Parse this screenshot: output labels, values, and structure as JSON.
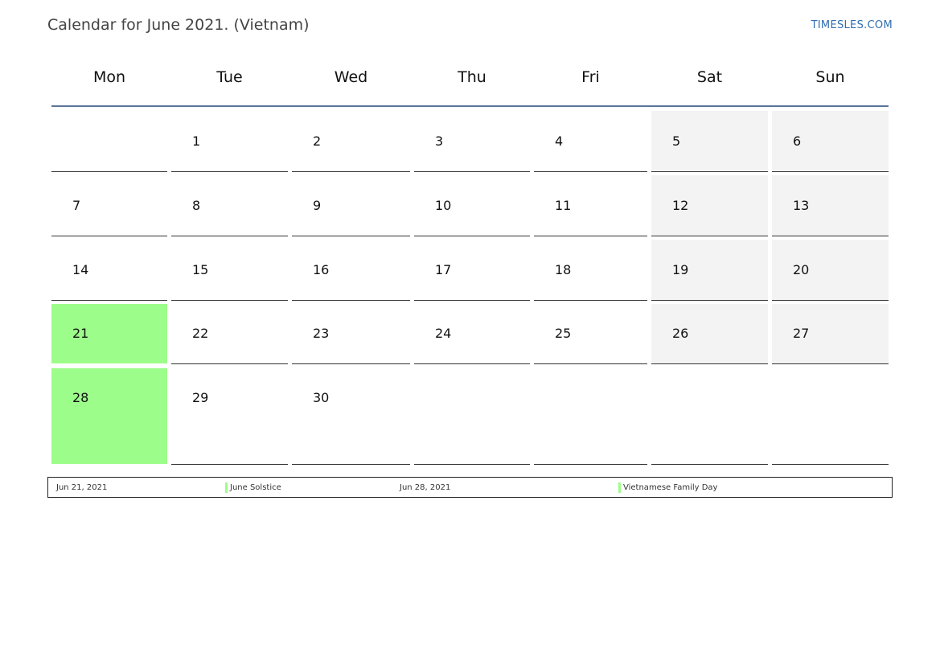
{
  "header": {
    "title": "Calendar for June 2021. (Vietnam)",
    "site_link": "TIMESLES.COM"
  },
  "calendar": {
    "weekdays": [
      "Mon",
      "Tue",
      "Wed",
      "Thu",
      "Fri",
      "Sat",
      "Sun"
    ],
    "rows": [
      [
        "",
        "1",
        "2",
        "3",
        "4",
        "5",
        "6"
      ],
      [
        "7",
        "8",
        "9",
        "10",
        "11",
        "12",
        "13"
      ],
      [
        "14",
        "15",
        "16",
        "17",
        "18",
        "19",
        "20"
      ],
      [
        "21",
        "22",
        "23",
        "24",
        "25",
        "26",
        "27"
      ],
      [
        "28",
        "29",
        "30",
        "",
        "",
        "",
        ""
      ]
    ],
    "holiday_color": "#9dfd8a",
    "weekend_color": "#f3f3f3",
    "accent_color": "#5a7599"
  },
  "legend": {
    "items": [
      {
        "date": "Jun 21, 2021",
        "name": "June Solstice"
      },
      {
        "date": "Jun 28, 2021",
        "name": "Vietnamese Family Day"
      }
    ]
  }
}
